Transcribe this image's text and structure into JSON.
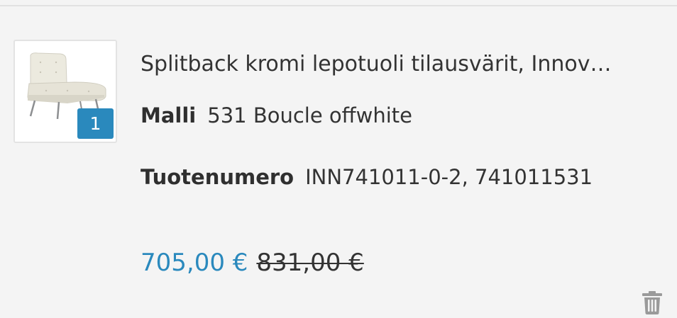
{
  "cart_item": {
    "title": "Splitback kromi lepotuoli tilausvärit, Innov…",
    "quantity": "1",
    "model_label": "Malli",
    "model_value": "531 Boucle offwhite",
    "sku_label": "Tuotenumero",
    "sku_value": "INN741011-0-2, 741011531",
    "price_current": "705,00 €",
    "price_original": "831,00 €",
    "product_image_icon": "lounge-chair-image",
    "delete_icon": "trash-icon"
  },
  "colors": {
    "accent": "#2a89bd",
    "background": "#f4f4f4",
    "text": "#333333",
    "icon": "#9a9a9a"
  }
}
